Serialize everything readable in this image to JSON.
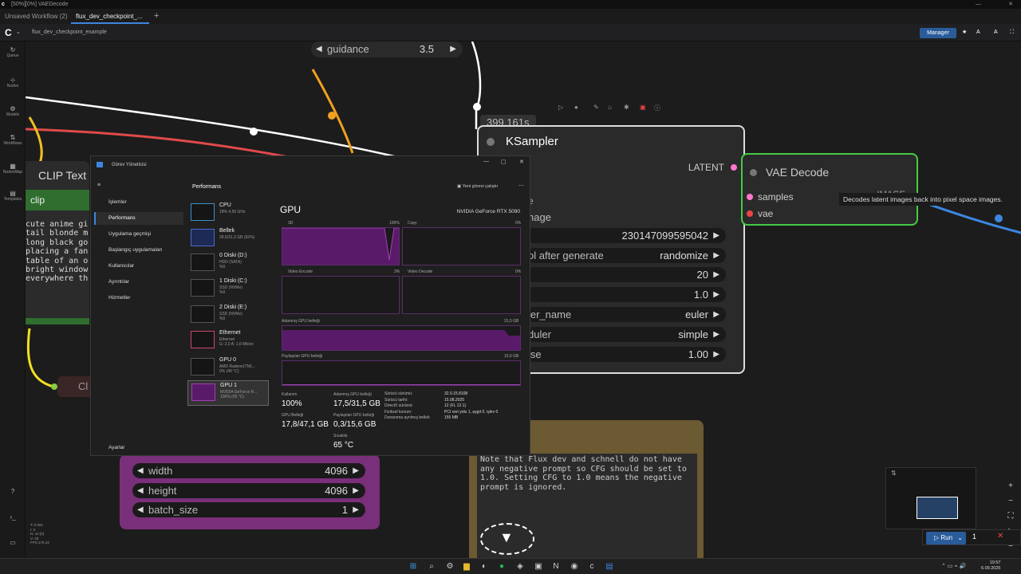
{
  "window": {
    "title": "[50%][0%] VAEDecode"
  },
  "tabs": [
    {
      "label": "Unsaved Workflow (2)"
    },
    {
      "label": "flux_dev_checkpoint_..."
    }
  ],
  "breadcrumb": "flux_dev_checkpoint_example",
  "manager_label": "Manager",
  "sidebar": [
    {
      "label": "Queue",
      "badge": "1"
    },
    {
      "label": "Nodes"
    },
    {
      "label": "Models"
    },
    {
      "label": "Workflows"
    },
    {
      "label": "NodesMap"
    },
    {
      "label": "Templates"
    }
  ],
  "guidance": {
    "label": "guidance",
    "value": "3.5"
  },
  "ksampler": {
    "timer": "399.161s",
    "title": "KSampler",
    "output": "LATENT",
    "image_label": "nage",
    "seed": "230147099595042",
    "control_label": "ol after generate",
    "control_value": "randomize",
    "steps": "20",
    "cfg": "1.0",
    "sampler_label": "ler_name",
    "sampler_value": "euler",
    "scheduler_label": "duler",
    "scheduler_value": "simple",
    "denoise_label": "ise",
    "denoise_value": "1.00",
    "e_label": "e"
  },
  "vae": {
    "title": "VAE Decode",
    "in1": "samples",
    "in2": "vae",
    "out": "IMAGE",
    "tooltip": "Decodes latent images back into pixel space images."
  },
  "clip": {
    "title": "CLIP Text",
    "input": "clip",
    "text": [
      "cute anime gi",
      "tail blonde m",
      "long black go",
      "placing a fan",
      "table of an o",
      "bright window",
      "everywhere th"
    ],
    "c_label": "Cl"
  },
  "latent": {
    "width_label": "width",
    "width": "4096",
    "height_label": "height",
    "height": "4096",
    "batch_label": "batch_size",
    "batch": "1"
  },
  "note": {
    "text": "Note that Flux dev and schnell do not have any negative prompt so CFG should be set to 1.0. Setting CFG to 1.0 means the negative prompt is ignored."
  },
  "run": {
    "label": "Run",
    "count": "1"
  },
  "stats": [
    "T: 0.00s",
    "I: 0",
    "N: 10 [0]",
    "V: 28",
    "FPS:175.44"
  ],
  "taskmgr": {
    "title": "Görev Yöneticisi",
    "section": "Performans",
    "new_task": "Yeni görevi çalıştır",
    "nav": [
      "İşlemler",
      "Performans",
      "Uygulama geçmişi",
      "Başlangıç uygulamaları",
      "Kullanıcılar",
      "Ayrıntılar",
      "Hizmetler"
    ],
    "settings": "Ayarlar",
    "items": [
      {
        "name": "CPU",
        "sub": "18% 4,56 GHz"
      },
      {
        "name": "Bellek",
        "sub": "28,6/31,2 GB (92%)"
      },
      {
        "name": "0 Diski (D:)",
        "sub": "HDD (SATA)\n%0"
      },
      {
        "name": "1 Diski (C:)",
        "sub": "SSD (NVMe)\n%0"
      },
      {
        "name": "2 Diski (E:)",
        "sub": "SSD (NVMe)\n%0"
      },
      {
        "name": "Ethernet",
        "sub": "Ethernet\nG: 2,0 A: 1,6 Mb/sn"
      },
      {
        "name": "GPU 0",
        "sub": "AMD Radeon(TM)...\n0% (49 °C)"
      },
      {
        "name": "GPU 1",
        "sub": "NVIDIA GeForce R...\n100% (65 °C)"
      }
    ],
    "gpu_title": "GPU",
    "gpu_model": "NVIDIA GeForce RTX 5090",
    "g3d": "3D",
    "g3d_pct": "100%",
    "gcopy": "Copy",
    "gcopy_pct": "0%",
    "genc": "Video Encode",
    "genc_pct": "3%",
    "gdec": "Video Decode",
    "gdec_pct": "0%",
    "ded_label": "Adanmış GPU belleği",
    "ded_max": "31,5 GB",
    "sh_label": "Paylaşılan GPU belleği",
    "sh_max": "15,6 GB",
    "usage_label": "Kullanım",
    "usage": "100%",
    "ded_use_label": "Adanmış GPU belleği",
    "ded_use": "17,5/31,5 GB",
    "gpu_mem_label": "GPU Belleği",
    "gpu_mem": "17,8/47,1 GB",
    "sh_use_label": "Paylaşılan GPU belleği",
    "sh_use": "0,3/15,6 GB",
    "temp_label": "Sıcaklık",
    "temp": "65 °C",
    "details": [
      [
        "Sürücü sürümü:",
        "32.0.15.8108"
      ],
      [
        "Sürücü tarihi:",
        "15.08.2025"
      ],
      [
        "DirectX sürümü:",
        "12 (FL 12.1)"
      ],
      [
        "Fiziksel konum:",
        "PCI veri yolu 1, aygıt 0, işlev 0"
      ],
      [
        "Donanıma ayrılmış bellek:",
        "155 MB"
      ]
    ]
  },
  "clock": {
    "time": "19:57",
    "date": "6.09.2025"
  }
}
